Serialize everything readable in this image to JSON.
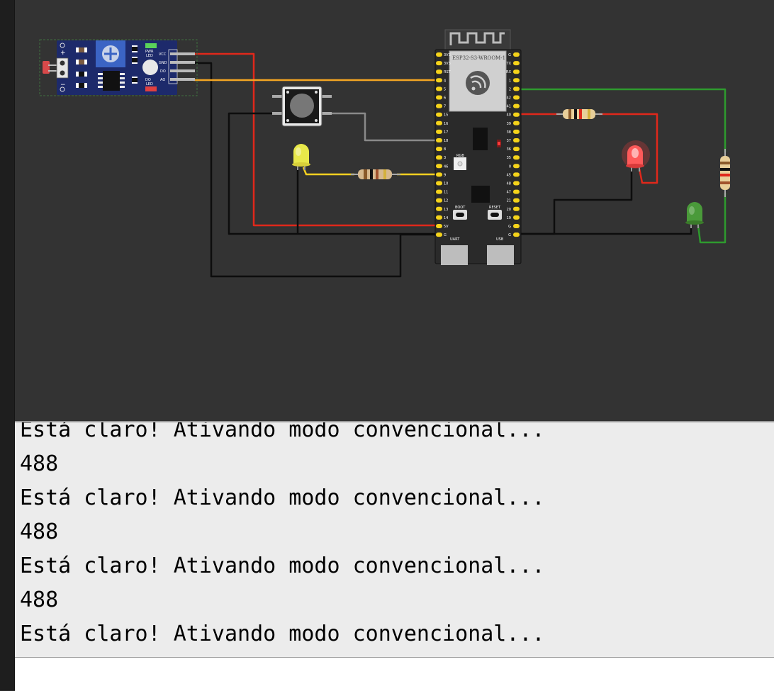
{
  "board": {
    "module_name": "ESP32-S3-WROOM-1",
    "left_pins": [
      "3V3",
      "3V3",
      "RST",
      "4",
      "5",
      "6",
      "7",
      "15",
      "16",
      "17",
      "18",
      "8",
      "3",
      "46",
      "9",
      "10",
      "11",
      "12",
      "13",
      "14",
      "5V",
      "G"
    ],
    "right_pins": [
      "G",
      "TX",
      "RX",
      "1",
      "2",
      "42",
      "41",
      "40",
      "39",
      "38",
      "37",
      "36",
      "35",
      "0",
      "45",
      "48",
      "47",
      "21",
      "20",
      "19",
      "G",
      "G"
    ],
    "rgb_label": "RGB",
    "boot_label": "BOOT",
    "reset_label": "RESET",
    "uart_label": "UART",
    "usb_label": "USB"
  },
  "ldr_module": {
    "pins": [
      "VCC",
      "GND",
      "DO",
      "AO"
    ],
    "pwr_led_label": "PWR LED",
    "do_led_label": "DO LED"
  },
  "components": {
    "yellow_led": "yellow-led",
    "red_led": "red-led",
    "green_led": "green-led",
    "pushbutton": "pushbutton"
  },
  "colors": {
    "canvas": "#333333",
    "wire_red": "#e0281b",
    "wire_black": "#0d0d0d",
    "wire_orange": "#f5a623",
    "wire_green": "#2e9a2e",
    "wire_yellow": "#f5d020",
    "wire_gray": "#8a8a8a",
    "board": "#2a2a2a",
    "pin": "#f5d31a"
  },
  "serial_monitor": {
    "lines": [
      "Está claro! Ativando modo convencional...",
      "488",
      "Está claro! Ativando modo convencional...",
      "488",
      "Está claro! Ativando modo convencional...",
      "488",
      "Está claro! Ativando modo convencional..."
    ]
  }
}
